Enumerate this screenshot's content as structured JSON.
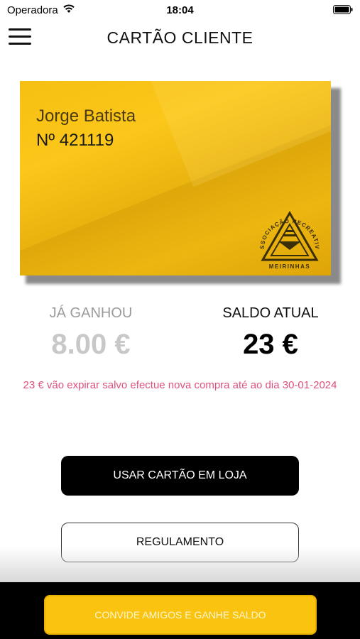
{
  "status_bar": {
    "carrier": "Operadora",
    "time": "18:04"
  },
  "header": {
    "title": "CARTÃO CLIENTE"
  },
  "card": {
    "holder_name": "Jorge Batista",
    "number": "Nº 421119",
    "logo_text_top": "ASSOCIAÇÃO RECREATIVA",
    "logo_text_bottom": "MEIRINHAS",
    "color": "#fbc71a"
  },
  "balance": {
    "earned_label": "JÁ GANHOU",
    "earned_value": "8.00 €",
    "current_label": "SALDO ATUAL",
    "current_value": "23 €"
  },
  "expiry_note": "23 € vão expirar salvo efectue nova compra até ao dia 30-01-2024",
  "buttons": {
    "use_card": "USAR CARTÃO EM LOJA",
    "rules": "REGULAMENTO",
    "invite": "CONVIDE AMIGOS E GANHE SALDO"
  },
  "colors": {
    "accent": "#f9c30f",
    "warning_text": "#e0507a"
  }
}
